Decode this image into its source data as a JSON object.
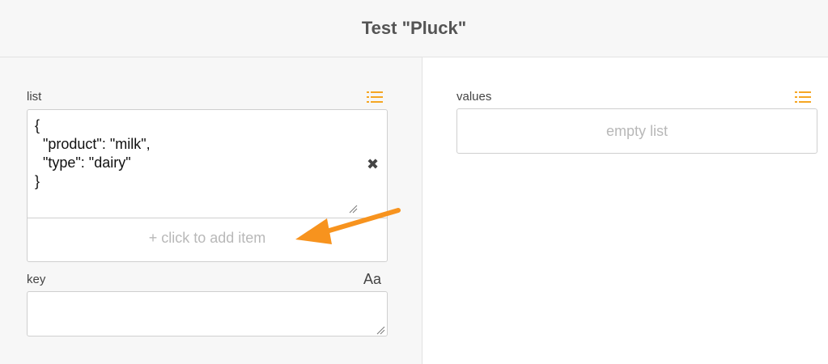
{
  "header": {
    "title": "Test \"Pluck\""
  },
  "inputs": {
    "list": {
      "label": "list",
      "items": [
        "{\n  \"product\": \"milk\",\n  \"type\": \"dairy\"\n}"
      ],
      "add_item_text": "+ click to add item"
    },
    "key": {
      "label": "key",
      "type_indicator": "Aa",
      "value": ""
    }
  },
  "outputs": {
    "values": {
      "label": "values",
      "empty_text": "empty list"
    }
  },
  "colors": {
    "accent": "#f5a623",
    "arrow": "#f7931e"
  },
  "icons": [
    "list-icon",
    "remove-x-icon",
    "resize-handle-icon",
    "arrow-annotation"
  ]
}
